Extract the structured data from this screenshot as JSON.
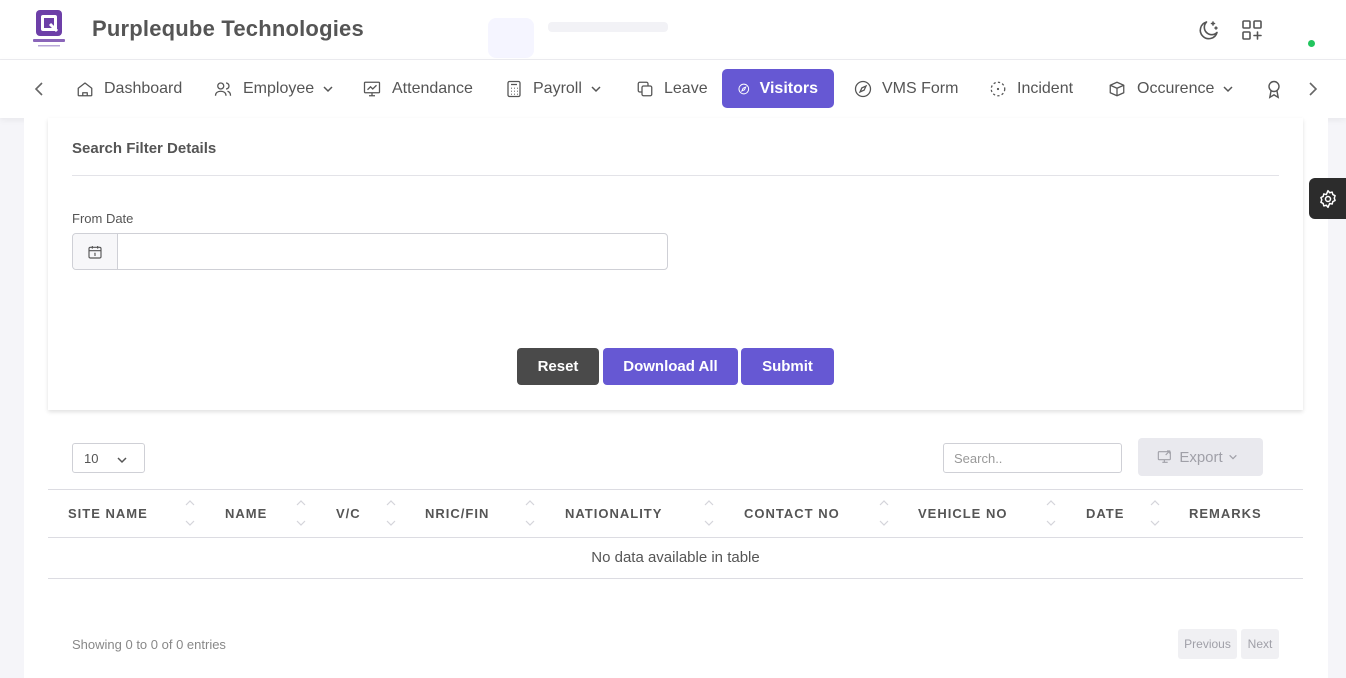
{
  "header": {
    "brand_title": "Purpleqube Technologies",
    "logo_text": "PURPLEQUBE",
    "icons": [
      "moon-icon",
      "apps-grid-icon"
    ],
    "online_status_color": "#22c55e"
  },
  "nav": {
    "items": [
      {
        "label": "Dashboard",
        "icon": "home-icon"
      },
      {
        "label": "Employee",
        "icon": "users-icon",
        "has_dropdown": true
      },
      {
        "label": "Attendance",
        "icon": "presentation-chart-icon"
      },
      {
        "label": "Payroll",
        "icon": "calculator-icon",
        "has_dropdown": true
      },
      {
        "label": "Leave",
        "icon": "copy-icon"
      },
      {
        "label": "Visitors",
        "icon": "compass-icon",
        "active": true
      },
      {
        "label": "VMS Form",
        "icon": "compass-icon"
      },
      {
        "label": "Incident",
        "icon": "focus-icon"
      },
      {
        "label": "Occurence",
        "icon": "box-icon",
        "has_dropdown": true
      },
      {
        "label": "",
        "icon": "award-icon"
      }
    ],
    "active_color": "#6658d3"
  },
  "filter": {
    "title": "Search Filter Details",
    "from_date_label": "From Date",
    "from_date_value": "",
    "buttons": {
      "reset": "Reset",
      "download_all": "Download All",
      "submit": "Submit"
    }
  },
  "table": {
    "page_length": "10",
    "search_placeholder": "Search..",
    "export_label": "Export",
    "columns": [
      "SITE NAME",
      "NAME",
      "V/C",
      "NRIC/FIN",
      "NATIONALITY",
      "CONTACT NO",
      "VEHICLE NO",
      "DATE",
      "REMARKS"
    ],
    "empty_message": "No data available in table",
    "info": "Showing 0 to 0 of 0 entries",
    "pagination": {
      "previous": "Previous",
      "next": "Next"
    }
  }
}
